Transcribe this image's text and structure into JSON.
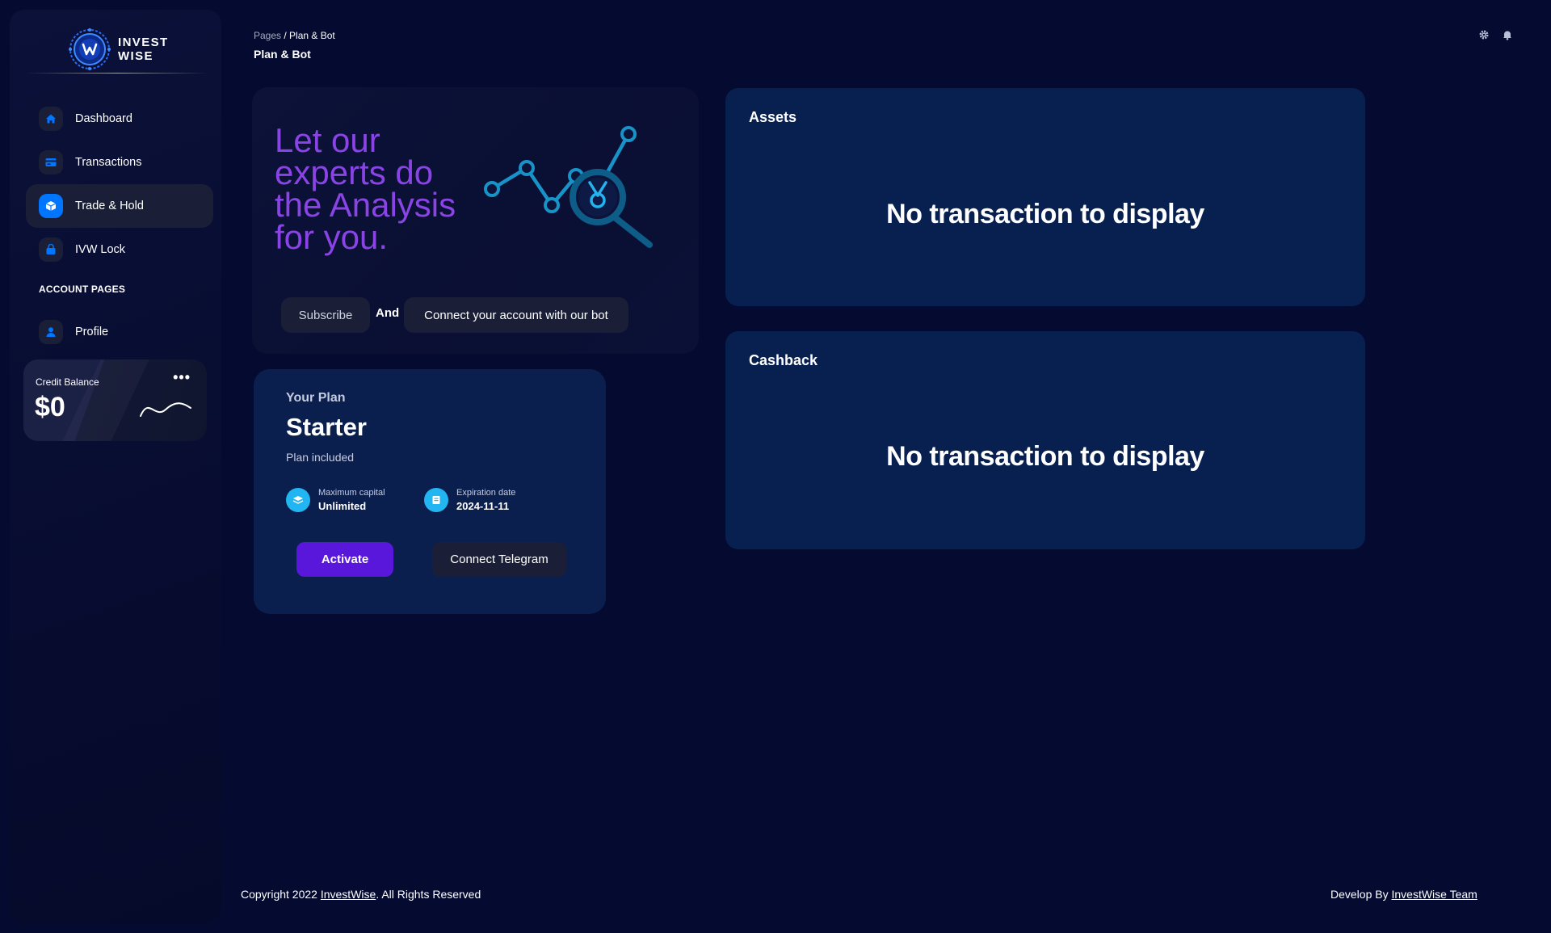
{
  "brand": {
    "line1": "INVEST",
    "line2": "WISE"
  },
  "sidebar": {
    "items": [
      {
        "label": "Dashboard",
        "icon": "home-icon"
      },
      {
        "label": "Transactions",
        "icon": "card-icon"
      },
      {
        "label": "Trade & Hold",
        "icon": "cube-icon",
        "active": true
      },
      {
        "label": "IVW Lock",
        "icon": "lock-bag-icon"
      }
    ],
    "section_label": "ACCOUNT PAGES",
    "account_items": [
      {
        "label": "Profile",
        "icon": "user-icon"
      }
    ],
    "credit": {
      "label": "Credit Balance",
      "value": "$0",
      "menu": "•••"
    }
  },
  "header": {
    "breadcrumb_root": "Pages",
    "breadcrumb_sep": " / ",
    "breadcrumb_current": "Plan & Bot",
    "title": "Plan & Bot",
    "icons": [
      "gear-icon",
      "bell-icon"
    ]
  },
  "promo": {
    "heading": "Let our experts do the Analysis for you.",
    "subscribe_label": "Subscribe",
    "and_label": "And",
    "connect_label": "Connect your account with our bot"
  },
  "plan": {
    "label": "Your Plan",
    "name": "Starter",
    "subtitle": "Plan included",
    "stats": [
      {
        "label": "Maximum capital",
        "value": "Unlimited"
      },
      {
        "label": "Expiration date",
        "value": "2024-11-11"
      }
    ],
    "activate_label": "Activate",
    "telegram_label": "Connect Telegram"
  },
  "assets": {
    "title": "Assets",
    "empty": "No transaction to display"
  },
  "cashback": {
    "title": "Cashback",
    "empty": "No transaction to display"
  },
  "footer": {
    "copyright_prefix": "Copyright 2022 ",
    "copyright_link": "InvestWise",
    "copyright_suffix": ". All Rights Reserved",
    "develop_prefix": "Develop By ",
    "develop_link": "InvestWise Team"
  },
  "colors": {
    "background": "#050a30",
    "accent_blue": "#0075ff",
    "purple_text": "#8a44e6",
    "activate_button": "#5a17dc",
    "panel": "#08204f",
    "stat_icon": "#21b6f2"
  }
}
